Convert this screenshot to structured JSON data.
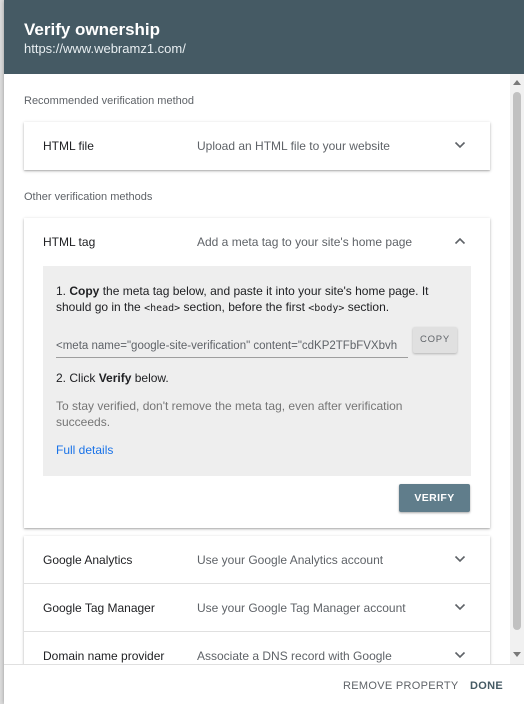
{
  "header": {
    "title": "Verify ownership",
    "url": "https://www.webramz1.com/"
  },
  "sections": {
    "recommended": "Recommended verification method",
    "other": "Other verification methods"
  },
  "methods": [
    {
      "name": "HTML file",
      "description": "Upload an HTML file to your website",
      "icon": "chevron-down-icon"
    },
    {
      "name": "HTML tag",
      "description": "Add a meta tag to your site's home page",
      "icon": "chevron-up-icon"
    },
    {
      "name": "Google Analytics",
      "description": "Use your Google Analytics account",
      "icon": "chevron-down-icon"
    },
    {
      "name": "Google Tag Manager",
      "description": "Use your Google Tag Manager account",
      "icon": "chevron-down-icon"
    },
    {
      "name": "Domain name provider",
      "description": "Associate a DNS record with Google",
      "icon": "chevron-down-icon"
    }
  ],
  "html_tag_panel": {
    "step1": {
      "number": "1.",
      "bold": "Copy",
      "text1": " the meta tag below, and paste it into your site's home page. It should go in the ",
      "head_tag": "<head>",
      "text2": " section, before the first ",
      "body_tag": "<body>",
      "text3": " section."
    },
    "meta_value": "<meta name=\"google-site-verification\" content=\"cdKP2TFbFVXbvh",
    "copy_label": "COPY",
    "step2": {
      "number": "2.",
      "prefix": "Click ",
      "bold": "Verify",
      "suffix": " below."
    },
    "note": "To stay verified, don't remove the meta tag, even after verification succeeds.",
    "link": "Full details",
    "verify_label": "VERIFY"
  },
  "footer": {
    "remove_label": "REMOVE PROPERTY",
    "done_label": "DONE"
  },
  "colors": {
    "header_bg": "#455a64",
    "verify_bg": "#607d8b",
    "link": "#1a73e8",
    "panel_bg": "#eeeeee"
  }
}
